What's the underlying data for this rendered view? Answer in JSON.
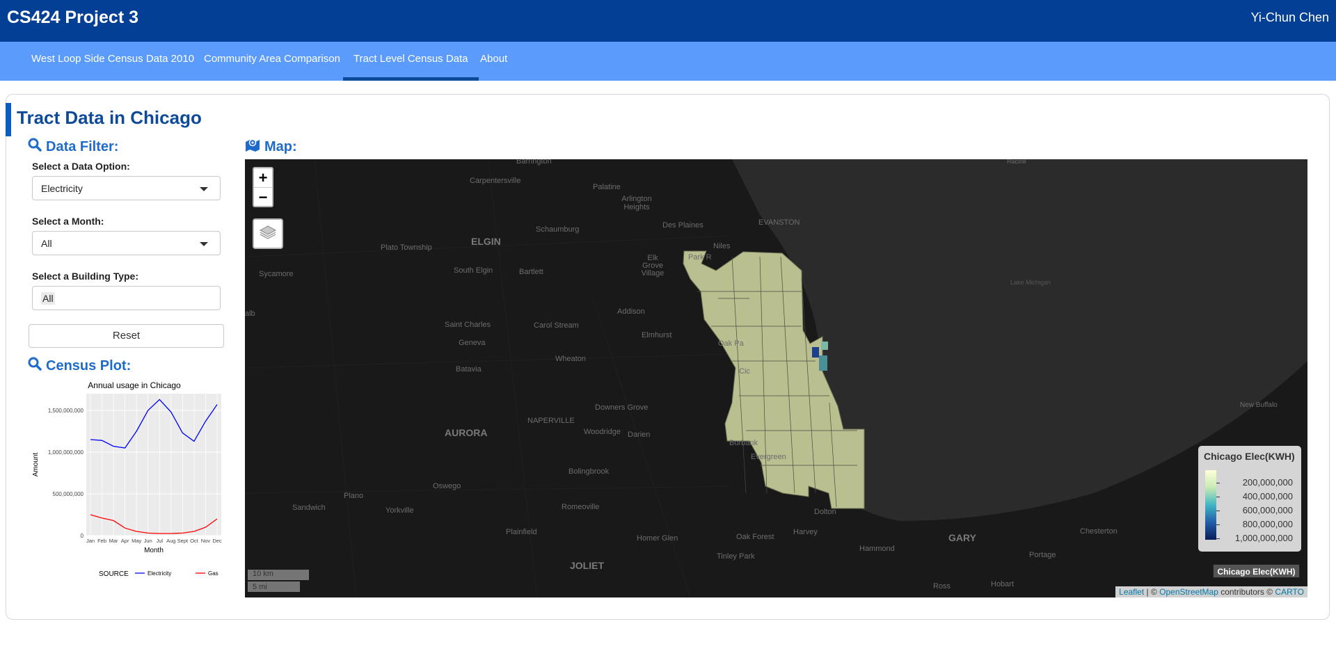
{
  "header": {
    "title": "CS424 Project 3",
    "user": "Yi-Chun Chen"
  },
  "nav": {
    "tabs": [
      {
        "label": "West Loop Side Census Data 2010"
      },
      {
        "label": "Community Area Comparison"
      },
      {
        "label": "Tract Level Census Data"
      },
      {
        "label": "About"
      }
    ],
    "active": "Tract Level Census Data"
  },
  "box": {
    "title": "Tract Data in Chicago"
  },
  "filter": {
    "heading": "Data Filter:",
    "data_option_label": "Select a Data Option:",
    "data_option_value": "Electricity",
    "month_label": "Select a Month:",
    "month_value": "All",
    "building_label": "Select a Building Type:",
    "building_value": "All",
    "reset_label": "Reset"
  },
  "census": {
    "heading": "Census Plot:"
  },
  "map": {
    "heading": "Map:",
    "zoom_in": "+",
    "zoom_out": "−",
    "places": [
      {
        "name": "Barrington"
      },
      {
        "name": "Carpentersville"
      },
      {
        "name": "Palatine"
      },
      {
        "name": "Arlington Heights"
      },
      {
        "name": "Des Plaines"
      },
      {
        "name": "EVANSTON"
      },
      {
        "name": "ELGIN"
      },
      {
        "name": "Schaumburg"
      },
      {
        "name": "Plato Township"
      },
      {
        "name": "Elk Grove Village"
      },
      {
        "name": "Park R"
      },
      {
        "name": "Niles"
      },
      {
        "name": "Sycamore"
      },
      {
        "name": "South Elgin"
      },
      {
        "name": "Bartlett"
      },
      {
        "name": "Addison"
      },
      {
        "name": "Saint Charles"
      },
      {
        "name": "Carol Stream"
      },
      {
        "name": "Elmhurst"
      },
      {
        "name": "Oak Pa"
      },
      {
        "name": "Geneva"
      },
      {
        "name": "Batavia"
      },
      {
        "name": "Wheaton"
      },
      {
        "name": "Cic"
      },
      {
        "name": "NAPERVILLE"
      },
      {
        "name": "Downers Grove"
      },
      {
        "name": "AURORA"
      },
      {
        "name": "Woodridge"
      },
      {
        "name": "Darien"
      },
      {
        "name": "Burbank"
      },
      {
        "name": "Bolingbrook"
      },
      {
        "name": "Evergreen"
      },
      {
        "name": "Oswego"
      },
      {
        "name": "Plano"
      },
      {
        "name": "Sandwich"
      },
      {
        "name": "Yorkville"
      },
      {
        "name": "Romeoville"
      },
      {
        "name": "Plainfield"
      },
      {
        "name": "Homer Glen"
      },
      {
        "name": "Oak Forest"
      },
      {
        "name": "Harvey"
      },
      {
        "name": "Dolton"
      },
      {
        "name": "Tinley Park"
      },
      {
        "name": "Hammond"
      },
      {
        "name": "GARY"
      },
      {
        "name": "Chesterton"
      },
      {
        "name": "Portage"
      },
      {
        "name": "JOLIET"
      },
      {
        "name": "Ross"
      },
      {
        "name": "Hobart"
      },
      {
        "name": "New Buffalo"
      },
      {
        "name": "Lake Michigan"
      },
      {
        "name": "Racine"
      },
      {
        "name": "alb"
      }
    ],
    "legend": {
      "title": "Chicago Elec(KWH)",
      "labels": [
        "200,000,000",
        "400,000,000",
        "600,000,000",
        "800,000,000",
        "1,000,000,000"
      ],
      "toggle_label": "Chicago Elec(KWH)"
    },
    "scale": {
      "km": "10 km",
      "mi": "5 mi"
    },
    "attribution": {
      "leaflet": "Leaflet",
      "sep": " | © ",
      "osm": "OpenStreetMap",
      "contrib": " contributors © ",
      "carto": "CARTO"
    }
  },
  "chart_data": {
    "type": "line",
    "title": "Annual usage in Chicago",
    "xlabel": "Month",
    "ylabel": "Amount",
    "categories": [
      "Jan",
      "Feb",
      "Mar",
      "Apr",
      "May",
      "Jun",
      "Jul",
      "Aug",
      "Sept",
      "Oct",
      "Nov",
      "Dec"
    ],
    "y_ticks": [
      0,
      500000000,
      1000000000,
      1500000000
    ],
    "y_tick_labels": [
      "0",
      "500,000,000",
      "1,000,000,000",
      "1,500,000,000"
    ],
    "ylim": [
      0,
      1700000000
    ],
    "legend_title": "SOURCE",
    "series": [
      {
        "name": "Electricity",
        "color": "#0000ff",
        "values": [
          1150000000,
          1140000000,
          1070000000,
          1050000000,
          1250000000,
          1500000000,
          1630000000,
          1480000000,
          1230000000,
          1130000000,
          1370000000,
          1570000000
        ]
      },
      {
        "name": "Gas",
        "color": "#ff0000",
        "values": [
          250000000,
          210000000,
          180000000,
          90000000,
          50000000,
          30000000,
          25000000,
          25000000,
          30000000,
          50000000,
          100000000,
          200000000
        ]
      }
    ]
  },
  "colors": {
    "header": "#043f96",
    "nav": "#5b9bfb",
    "accent": "#1e6bcc"
  }
}
